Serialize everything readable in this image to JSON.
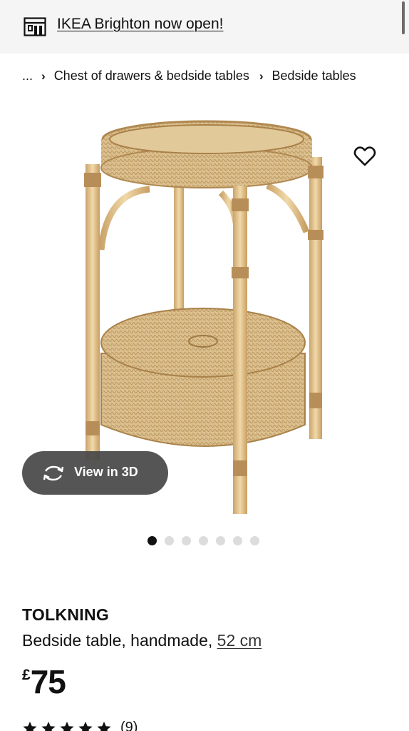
{
  "banner": {
    "text": "IKEA Brighton now open!",
    "icon": "store-icon"
  },
  "breadcrumb": {
    "ellipsis": "...",
    "items": [
      "Chest of drawers & bedside tables",
      "Bedside tables"
    ]
  },
  "gallery": {
    "view3d_label": "View in 3D",
    "slide_count": 7,
    "active_slide": 1
  },
  "product": {
    "name": "TOLKNING",
    "description": "Bedside table, handmade,",
    "size_link": "52 cm",
    "currency": "£",
    "price": "75",
    "rating": {
      "stars": 5,
      "count": "(9)"
    }
  },
  "colors": {
    "banner_bg": "#f5f5f5",
    "pill_bg": "#484848",
    "text": "#111111",
    "dot_inactive": "#dcdcdc"
  }
}
